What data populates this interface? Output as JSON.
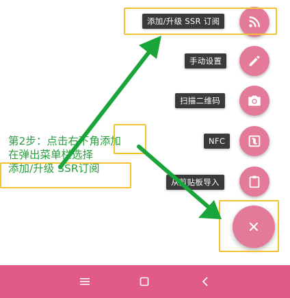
{
  "speed_dial": {
    "items": [
      {
        "label": "添加/升级 SSR 订阅",
        "icon": "rss-icon"
      },
      {
        "label": "手动设置",
        "icon": "pencil-icon"
      },
      {
        "label": "扫描二维码",
        "icon": "camera-icon"
      },
      {
        "label": "NFC",
        "icon": "nfc-icon"
      },
      {
        "label": "从剪贴板导入",
        "icon": "clipboard-icon"
      }
    ],
    "main_fab_icon": "close-icon"
  },
  "annotation": {
    "line1": "第2步：点击右下角添加",
    "line2": "在弹出菜单栏选择",
    "line3": "添加/升级 SSR订阅"
  },
  "navbar": {
    "buttons": [
      "menu-icon",
      "home-icon",
      "back-icon"
    ]
  },
  "colors": {
    "accent": "#e47a99",
    "navbar": "#e15b87",
    "highlight": "#f2c230",
    "arrow": "#19a53a",
    "annotation_text": "#2a9d3c",
    "label_bg": "#3a3a3a"
  }
}
